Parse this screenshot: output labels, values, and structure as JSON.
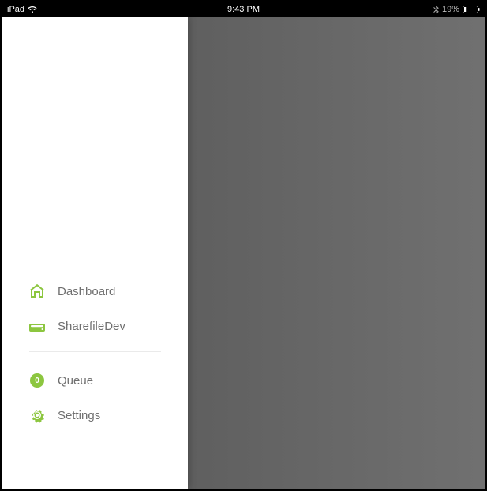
{
  "colors": {
    "accent": "#8cc63f",
    "label": "#6f6f6f"
  },
  "status_bar": {
    "device": "iPad",
    "time": "9:43 PM",
    "battery_percent": "19%"
  },
  "sidebar": {
    "items": [
      {
        "icon": "home-icon",
        "label": "Dashboard"
      },
      {
        "icon": "drive-icon",
        "label": "SharefileDev"
      }
    ],
    "secondary": [
      {
        "icon": "badge-icon",
        "badge": "0",
        "label": "Queue"
      },
      {
        "icon": "gear-icon",
        "label": "Settings"
      }
    ]
  }
}
